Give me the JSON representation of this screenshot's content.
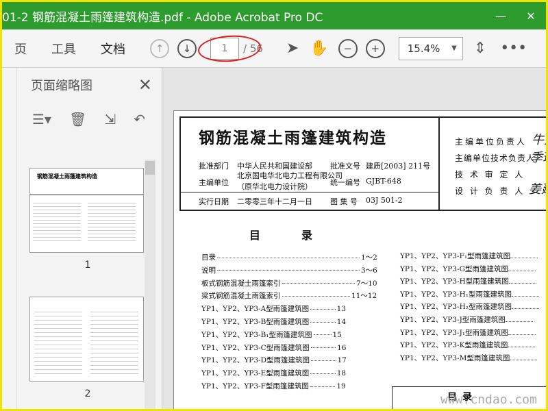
{
  "window": {
    "title": "01-2 钢筋混凝土雨篷建筑构造.pdf - Adobe Acrobat Pro DC",
    "minimize": "—",
    "maximize": "☐",
    "close": "✕"
  },
  "toolbar": {
    "tabs": [
      "页",
      "工具",
      "文档"
    ],
    "page_current": "1",
    "page_total": "/ 56",
    "zoom": "15.4%"
  },
  "panel": {
    "title": "页面缩略图",
    "thumbs": [
      {
        "label": "1"
      },
      {
        "label": "2"
      }
    ]
  },
  "document": {
    "title": "钢筋混凝土雨篷建筑构造",
    "meta": {
      "approve_dept_label": "批准部门",
      "approve_dept": "中华人民共和国建设部",
      "approve_no_label": "批准文号",
      "approve_no": "建质[2003] 211号",
      "editor_label": "主编单位",
      "editor_line1": "北京国电华北电力工程有限公司",
      "editor_line2": "（原华北电力设计院）",
      "serial_label": "统一编号",
      "serial": "GJBT-648",
      "date_label": "实行日期",
      "date": "二零零三年十二月一日",
      "atlas_label": "图 集 号",
      "atlas": "03J 501-2"
    },
    "responsible": [
      {
        "label": "主编单位负责人",
        "sig": "牛大"
      },
      {
        "label": "主编单位技术负责人",
        "sig": "季瑞"
      },
      {
        "label": "技 术 审 定 人",
        "sig": ""
      },
      {
        "label": "设 计 负 责 人",
        "sig": "姜建"
      }
    ],
    "toc_title": "目录",
    "toc_left": [
      {
        "name": "目录",
        "page": "1～2"
      },
      {
        "name": "说明",
        "page": "3～6"
      },
      {
        "name": "板式钢筋混凝土雨篷索引",
        "page": "7～10"
      },
      {
        "name": "梁式钢筋混凝土雨篷索引",
        "page": "11～12"
      },
      {
        "name": "YP1、YP2、YP3-A型雨篷建筑图",
        "page": "13"
      },
      {
        "name": "YP1、YP2、YP3-B型雨篷建筑图",
        "page": "14"
      },
      {
        "name": "YP1、YP2、YP3-B₁型雨篷建筑图",
        "page": "15"
      },
      {
        "name": "YP1、YP2、YP3-C型雨篷建筑图",
        "page": "16"
      },
      {
        "name": "YP1、YP2、YP3-D型雨篷建筑图",
        "page": "17"
      },
      {
        "name": "YP1、YP2、YP3-E型雨篷建筑图",
        "page": "18"
      },
      {
        "name": "YP1、YP2、YP3-F型雨篷建筑图",
        "page": "19"
      }
    ],
    "toc_right": [
      "YP1、YP2、YP3-F₁型雨篷建筑图",
      "YP1、YP2、YP3-G型雨篷建筑图",
      "YP1、YP2、YP3-H型雨篷建筑图",
      "YP1、YP2、YP3-H₁型雨篷建筑图",
      "YP1、YP2、YP3-H₂型雨篷建筑图",
      "YP1、YP2、YP3-J型雨篷建筑图",
      "YP1、YP2、YP3-J₁型雨篷建筑图",
      "YP1、YP2、YP3-K型雨篷建筑图",
      "YP1、YP2、YP3-M型雨篷建筑图"
    ],
    "bottom_label": "目录"
  },
  "watermark": "www.cndao.com"
}
